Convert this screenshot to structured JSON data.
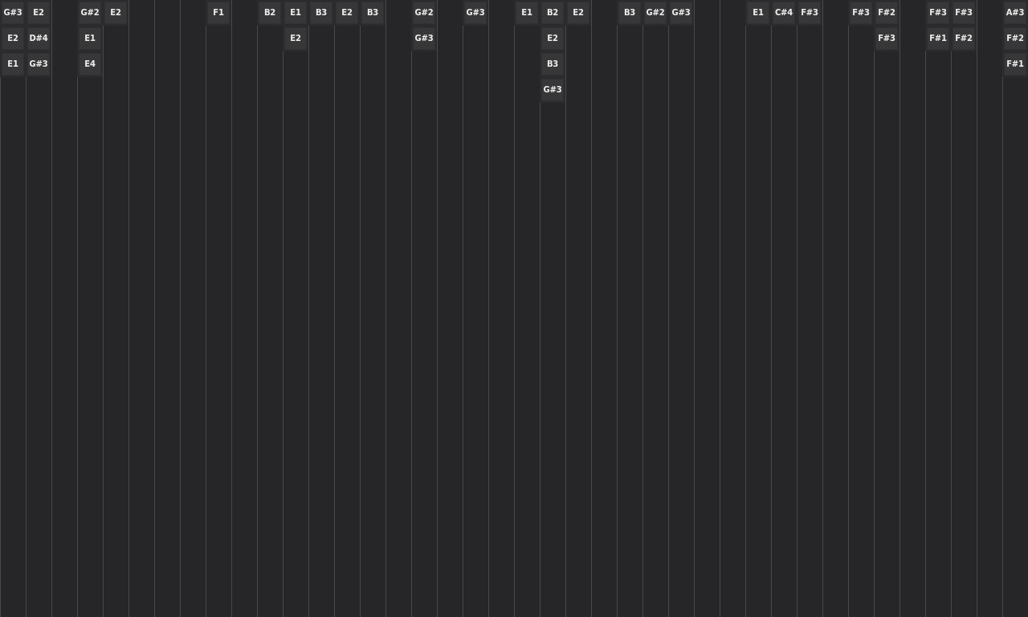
{
  "lanes": [
    {
      "kind": "notes",
      "notes": [
        "G#3",
        "E2",
        "E1"
      ]
    },
    {
      "kind": "notes",
      "notes": [
        "E2",
        "D#4",
        "G#3"
      ]
    },
    {
      "kind": "empty"
    },
    {
      "kind": "notes",
      "notes": [
        "G#2",
        "E1",
        "E4"
      ]
    },
    {
      "kind": "notes",
      "notes": [
        "E2"
      ]
    },
    {
      "kind": "empty"
    },
    {
      "kind": "empty"
    },
    {
      "kind": "empty"
    },
    {
      "kind": "notes",
      "notes": [
        "F1"
      ]
    },
    {
      "kind": "empty"
    },
    {
      "kind": "notes",
      "notes": [
        "B2"
      ]
    },
    {
      "kind": "notes",
      "notes": [
        "E1",
        "E2"
      ]
    },
    {
      "kind": "notes",
      "notes": [
        "B3"
      ]
    },
    {
      "kind": "notes",
      "notes": [
        "E2"
      ]
    },
    {
      "kind": "notes",
      "notes": [
        "B3"
      ]
    },
    {
      "kind": "empty"
    },
    {
      "kind": "notes",
      "notes": [
        "G#2",
        "G#3"
      ]
    },
    {
      "kind": "empty"
    },
    {
      "kind": "notes",
      "notes": [
        "G#3"
      ]
    },
    {
      "kind": "empty"
    },
    {
      "kind": "notes",
      "notes": [
        "E1"
      ]
    },
    {
      "kind": "notes",
      "notes": [
        "B2",
        "E2",
        "B3",
        "G#3"
      ]
    },
    {
      "kind": "notes",
      "notes": [
        "E2"
      ]
    },
    {
      "kind": "empty"
    },
    {
      "kind": "notes",
      "notes": [
        "B3"
      ]
    },
    {
      "kind": "notes",
      "notes": [
        "G#2"
      ]
    },
    {
      "kind": "notes",
      "notes": [
        "G#3"
      ]
    },
    {
      "kind": "empty"
    },
    {
      "kind": "empty"
    },
    {
      "kind": "notes",
      "notes": [
        "E1"
      ]
    },
    {
      "kind": "notes",
      "notes": [
        "C#4"
      ]
    },
    {
      "kind": "notes",
      "notes": [
        "F#3"
      ]
    },
    {
      "kind": "empty"
    },
    {
      "kind": "notes",
      "notes": [
        "F#3"
      ]
    },
    {
      "kind": "notes",
      "notes": [
        "F#2",
        "F#3"
      ]
    },
    {
      "kind": "empty"
    },
    {
      "kind": "notes",
      "notes": [
        "F#3",
        "F#1"
      ]
    },
    {
      "kind": "notes",
      "notes": [
        "F#3",
        "F#2"
      ]
    },
    {
      "kind": "empty"
    },
    {
      "kind": "notes",
      "notes": [
        "A#3",
        "F#2",
        "F#1"
      ]
    }
  ]
}
